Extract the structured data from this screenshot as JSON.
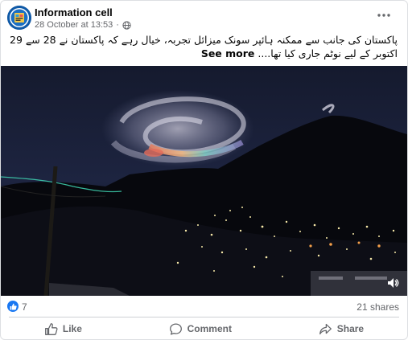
{
  "header": {
    "page_name": "Information cell",
    "date": "28 October at 13:53",
    "privacy_icon": "globe-icon",
    "more_icon": "more-options-icon"
  },
  "post": {
    "text": "پاکستان کی جانب سے ممکنہ ہائپر سونک میزائل تجربہ، خیال رہے کہ پاکستان نے 28 سے 29 اکتوبر کے لیے نوٹم جاری کیا تھا....",
    "see_more": "See more"
  },
  "media": {
    "volume_icon": "volume-icon"
  },
  "stats": {
    "reaction_icon": "like-reaction-icon",
    "reaction_count": "7",
    "shares": "21 shares"
  },
  "actions": [
    {
      "label": "Like",
      "icon": "thumbs-up-icon"
    },
    {
      "label": "Comment",
      "icon": "comment-icon"
    },
    {
      "label": "Share",
      "icon": "share-arrow-icon"
    }
  ],
  "colors": {
    "accent": "#1877f2",
    "secondary_text": "#65676b",
    "divider": "#ced0d4"
  }
}
